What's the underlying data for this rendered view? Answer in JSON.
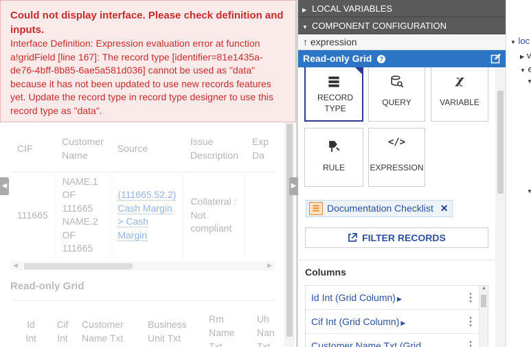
{
  "error": {
    "title": "Could not display interface. Please check definition and inputs.",
    "message": "Interface Definition: Expression evaluation error at function a!gridField [line 167]: The record type [identifier=81e1435a-de76-4bff-8b85-6ae5a581d036] cannot be used as \"data\" because it has not been updated to use new records features yet. Update the record type in record type designer to use this record type as \"data\"."
  },
  "grid1": {
    "headers": [
      "CIF",
      "Customer Name",
      "Source",
      "Issue Description",
      "Exp Da"
    ],
    "row": {
      "cif": "111665",
      "customer_name": "NAME.1 OF 111665 NAME.2 OF 111665",
      "source": "(111665.52.2) Cash Margin > Cash Margin",
      "issue": "Collateral : Not compliant"
    }
  },
  "grid2": {
    "label": "Read-only Grid",
    "headers": [
      "Id Int",
      "Cif Int",
      "Customer Name Txt",
      "Business Unit Txt",
      "Rm Name Txt",
      "Uh Nan Txt"
    ]
  },
  "panel": {
    "local_variables": "LOCAL VARIABLES",
    "component_configuration": "COMPONENT CONFIGURATION",
    "expression": "expression",
    "component_title": "Read-only Grid",
    "tiles": {
      "record_type": "RECORD TYPE",
      "query": "QUERY",
      "variable": "VARIABLE",
      "rule": "RULE",
      "expression": "EXPRESSION"
    },
    "selected_record": "Documentation Checklist",
    "filter_records": "FILTER RECORDS",
    "columns_title": "Columns",
    "columns": [
      "Id Int (Grid Column)",
      "Cif Int (Grid Column)",
      "Customer Name Txt (Grid"
    ]
  },
  "tree": {
    "rows": [
      "loc",
      "v",
      "e"
    ]
  },
  "colors": {
    "accent": "#2b75c4",
    "error_bg": "#fbeaea",
    "error_text": "#c62b2b",
    "header_bg": "#5a5a5a",
    "link": "#2b4fa0"
  }
}
